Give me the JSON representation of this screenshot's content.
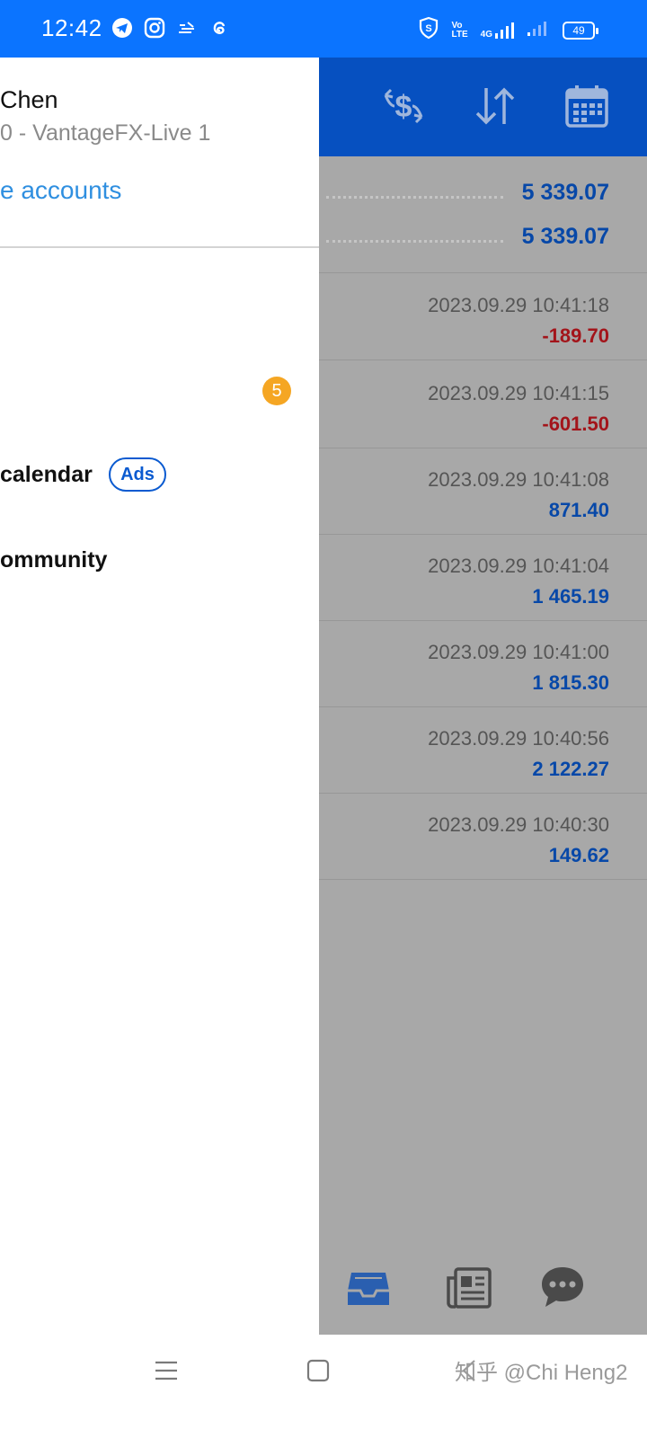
{
  "status_bar": {
    "time": "12:42",
    "app_icons": [
      "telegram-icon",
      "instagram-icon",
      "express-icon",
      "threads-icon"
    ],
    "network_label_top": "Vo",
    "network_label_bottom": "LTE",
    "network_type": "4G",
    "battery_level": "49"
  },
  "drawer": {
    "account_name": "Chen",
    "account_server": "0 - VantageFX-Live 1",
    "manage_accounts": "e accounts",
    "mailbox_badge": "5",
    "economic_calendar": "calendar",
    "ads_label": "Ads",
    "community": "ommunity"
  },
  "app": {
    "toolbar_icons": [
      "currency-exchange-icon",
      "sort-icon",
      "calendar-icon"
    ],
    "balances": [
      "5 339.07",
      "5 339.07"
    ],
    "deals": [
      {
        "time": "2023.09.29 10:41:18",
        "amount": "-189.70"
      },
      {
        "time": "2023.09.29 10:41:15",
        "amount": "-601.50"
      },
      {
        "time": "2023.09.29 10:41:08",
        "amount": "871.40"
      },
      {
        "time": "2023.09.29 10:41:04",
        "amount": "1 465.19"
      },
      {
        "time": "2023.09.29 10:41:00",
        "amount": "1 815.30"
      },
      {
        "time": "2023.09.29 10:40:56",
        "amount": "2 122.27"
      },
      {
        "time": "2023.09.29 10:40:30",
        "amount": "149.62"
      }
    ],
    "bottom_tabs": [
      "inbox-icon",
      "news-icon",
      "chat-icon"
    ]
  },
  "colors": {
    "status_bar": "#0b74ff",
    "toolbar": "#0650c0",
    "positive": "#0748a8",
    "negative": "#a3141a",
    "badge": "#f5a623",
    "link": "#2f8fe0"
  },
  "nav_bar": {
    "watermark": "知乎 @Chi Heng2"
  }
}
